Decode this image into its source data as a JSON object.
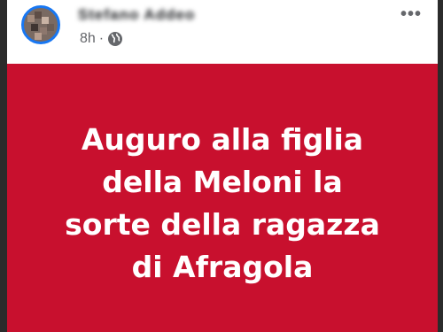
{
  "post": {
    "author_name": "Stefano Addeo",
    "time": "8h",
    "separator": "·",
    "audience_icon": "globe-icon",
    "more_icon": "more-horizontal-icon",
    "more_label": "•••",
    "text": "Auguro alla figlia\ndella Meloni la\nsorte della ragazza\ndi Afragola",
    "background_color": "#c8102e",
    "text_color": "#ffffff",
    "avatar_ring_color": "#1877f2"
  }
}
